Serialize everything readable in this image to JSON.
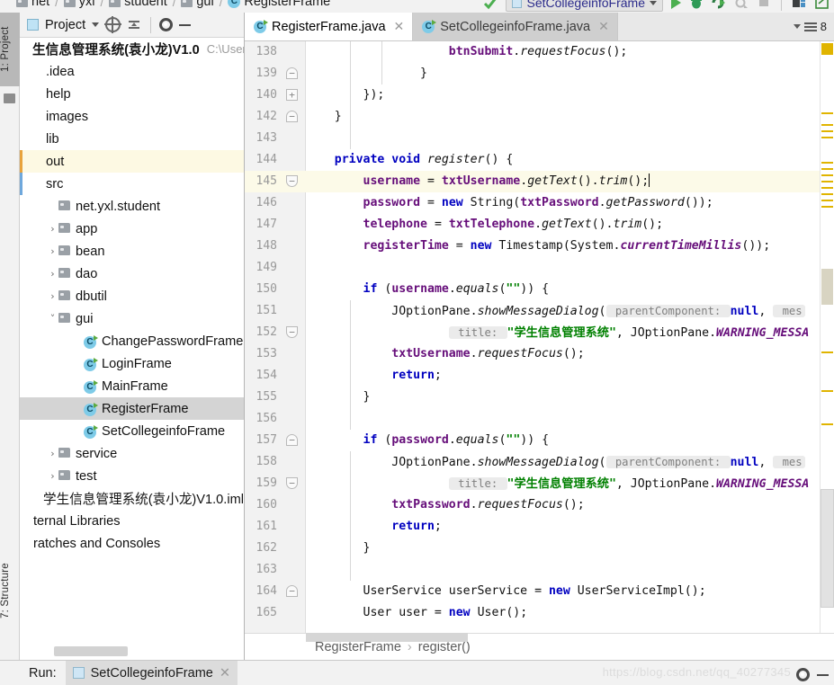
{
  "breadcrumb_top": {
    "items": [
      "net",
      "yxl",
      "student",
      "gui",
      "RegisterFrame"
    ]
  },
  "toolbar": {
    "run_config": "SetCollegeinfoFrame",
    "icons": [
      "run-icon",
      "debug-icon",
      "run-coverage-icon",
      "profile-icon",
      "stop-icon",
      "layout-icon",
      "open-window-icon"
    ]
  },
  "tool_tabs": {
    "left_top": "1: Project",
    "left_bottom": "7: Structure"
  },
  "project_panel": {
    "title": "Project",
    "root": {
      "name": "生信息管理系统(袁小龙)V1.0",
      "path": "C:\\User"
    },
    "items": [
      {
        "label": ".idea",
        "indent": 1,
        "icon": "folder-icon",
        "arrow": "",
        "state": "normal"
      },
      {
        "label": "help",
        "indent": 1,
        "icon": "folder-icon",
        "arrow": "",
        "state": "normal"
      },
      {
        "label": "images",
        "indent": 1,
        "icon": "folder-icon",
        "arrow": "",
        "state": "normal"
      },
      {
        "label": "lib",
        "indent": 1,
        "icon": "folder-icon",
        "arrow": "",
        "state": "normal"
      },
      {
        "label": "out",
        "indent": 1,
        "icon": "folder-icon",
        "arrow": "",
        "state": "excluded"
      },
      {
        "label": "src",
        "indent": 1,
        "icon": "source-folder-icon",
        "arrow": "",
        "state": "source"
      },
      {
        "label": "net.yxl.student",
        "indent": 2,
        "icon": "package-icon",
        "arrow": "",
        "state": "normal"
      },
      {
        "label": "app",
        "indent": 2,
        "icon": "package-icon",
        "arrow": "›",
        "state": "normal"
      },
      {
        "label": "bean",
        "indent": 2,
        "icon": "package-icon",
        "arrow": "›",
        "state": "normal"
      },
      {
        "label": "dao",
        "indent": 2,
        "icon": "package-icon",
        "arrow": "›",
        "state": "normal"
      },
      {
        "label": "dbutil",
        "indent": 2,
        "icon": "package-icon",
        "arrow": "›",
        "state": "normal"
      },
      {
        "label": "gui",
        "indent": 2,
        "icon": "package-icon",
        "arrow": "˅",
        "state": "normal"
      },
      {
        "label": "ChangePasswordFrame",
        "indent": 4,
        "icon": "java-class-icon",
        "arrow": "",
        "state": "normal"
      },
      {
        "label": "LoginFrame",
        "indent": 4,
        "icon": "java-runnable-class-icon",
        "arrow": "",
        "state": "normal"
      },
      {
        "label": "MainFrame",
        "indent": 4,
        "icon": "java-runnable-class-icon",
        "arrow": "",
        "state": "normal"
      },
      {
        "label": "RegisterFrame",
        "indent": 4,
        "icon": "java-runnable-class-icon",
        "arrow": "",
        "state": "selected"
      },
      {
        "label": "SetCollegeinfoFrame",
        "indent": 4,
        "icon": "java-runnable-class-icon",
        "arrow": "",
        "state": "normal"
      },
      {
        "label": "service",
        "indent": 2,
        "icon": "package-icon",
        "arrow": "›",
        "state": "normal"
      },
      {
        "label": "test",
        "indent": 2,
        "icon": "package-icon",
        "arrow": "›",
        "state": "normal"
      },
      {
        "label": "学生信息管理系统(袁小龙)V1.0.iml",
        "indent": 1,
        "icon": "iml-file-icon",
        "arrow": "",
        "state": "normal"
      },
      {
        "label": "ternal Libraries",
        "indent": 0,
        "icon": "library-icon",
        "arrow": "",
        "state": "normal"
      },
      {
        "label": "ratches and Consoles",
        "indent": 0,
        "icon": "scratches-icon",
        "arrow": "",
        "state": "normal"
      }
    ]
  },
  "editor": {
    "tabs": [
      {
        "label": "RegisterFrame.java",
        "active": true,
        "icon": "java-runnable-class-icon"
      },
      {
        "label": "SetCollegeinfoFrame.java",
        "active": false,
        "icon": "java-runnable-class-icon"
      }
    ],
    "tab_count": "8",
    "lines": [
      {
        "num": "138",
        "segs": [
          {
            "t": "                    ",
            "c": "plain"
          },
          {
            "t": "btnSubmit",
            "c": "fld"
          },
          {
            "t": ".",
            "c": "plain"
          },
          {
            "t": "requestFocus",
            "c": "mth"
          },
          {
            "t": "();",
            "c": "plain"
          }
        ]
      },
      {
        "num": "139",
        "segs": [
          {
            "t": "                }",
            "c": "plain"
          }
        ]
      },
      {
        "num": "140",
        "segs": [
          {
            "t": "        });",
            "c": "plain"
          }
        ]
      },
      {
        "num": "142",
        "segs": [
          {
            "t": "    }",
            "c": "plain"
          }
        ]
      },
      {
        "num": "143",
        "segs": [
          {
            "t": "",
            "c": "plain"
          }
        ]
      },
      {
        "num": "144",
        "segs": [
          {
            "t": "    ",
            "c": "plain"
          },
          {
            "t": "private void ",
            "c": "kw"
          },
          {
            "t": "register",
            "c": "mth"
          },
          {
            "t": "() {",
            "c": "plain"
          }
        ]
      },
      {
        "num": "145",
        "current": true,
        "segs": [
          {
            "t": "        ",
            "c": "plain"
          },
          {
            "t": "username",
            "c": "fld"
          },
          {
            "t": " = ",
            "c": "plain"
          },
          {
            "t": "txtUsername",
            "c": "fld"
          },
          {
            "t": ".",
            "c": "plain"
          },
          {
            "t": "getText",
            "c": "mth"
          },
          {
            "t": "().",
            "c": "plain"
          },
          {
            "t": "trim",
            "c": "mth"
          },
          {
            "t": "();",
            "c": "plain"
          }
        ],
        "caret": true
      },
      {
        "num": "146",
        "segs": [
          {
            "t": "        ",
            "c": "plain"
          },
          {
            "t": "password",
            "c": "fld"
          },
          {
            "t": " = ",
            "c": "plain"
          },
          {
            "t": "new ",
            "c": "kw"
          },
          {
            "t": "String(",
            "c": "plain"
          },
          {
            "t": "txtPassword",
            "c": "fld"
          },
          {
            "t": ".",
            "c": "plain"
          },
          {
            "t": "getPassword",
            "c": "mth"
          },
          {
            "t": "());",
            "c": "plain"
          }
        ]
      },
      {
        "num": "147",
        "segs": [
          {
            "t": "        ",
            "c": "plain"
          },
          {
            "t": "telephone",
            "c": "fld"
          },
          {
            "t": " = ",
            "c": "plain"
          },
          {
            "t": "txtTelephone",
            "c": "fld"
          },
          {
            "t": ".",
            "c": "plain"
          },
          {
            "t": "getText",
            "c": "mth"
          },
          {
            "t": "().",
            "c": "plain"
          },
          {
            "t": "trim",
            "c": "mth"
          },
          {
            "t": "();",
            "c": "plain"
          }
        ]
      },
      {
        "num": "148",
        "segs": [
          {
            "t": "        ",
            "c": "plain"
          },
          {
            "t": "registerTime",
            "c": "fld"
          },
          {
            "t": " = ",
            "c": "plain"
          },
          {
            "t": "new ",
            "c": "kw"
          },
          {
            "t": "Timestamp(System.",
            "c": "plain"
          },
          {
            "t": "currentTimeMillis",
            "c": "stat"
          },
          {
            "t": "());",
            "c": "plain"
          }
        ]
      },
      {
        "num": "149",
        "segs": [
          {
            "t": "",
            "c": "plain"
          }
        ]
      },
      {
        "num": "150",
        "segs": [
          {
            "t": "        ",
            "c": "plain"
          },
          {
            "t": "if ",
            "c": "kw"
          },
          {
            "t": "(",
            "c": "plain"
          },
          {
            "t": "username",
            "c": "fld"
          },
          {
            "t": ".",
            "c": "plain"
          },
          {
            "t": "equals",
            "c": "mth"
          },
          {
            "t": "(",
            "c": "plain"
          },
          {
            "t": "\"\"",
            "c": "str"
          },
          {
            "t": ")) {",
            "c": "plain"
          }
        ]
      },
      {
        "num": "151",
        "segs": [
          {
            "t": "            ",
            "c": "plain"
          },
          {
            "t": "JOptionPane.",
            "c": "plain"
          },
          {
            "t": "showMessageDialog",
            "c": "mth"
          },
          {
            "t": "(",
            "c": "plain"
          },
          {
            "t": " parentComponent: ",
            "c": "hint"
          },
          {
            "t": "null",
            "c": "kw"
          },
          {
            "t": ", ",
            "c": "plain"
          },
          {
            "t": " mes",
            "c": "hint"
          }
        ]
      },
      {
        "num": "152",
        "segs": [
          {
            "t": "                    ",
            "c": "plain"
          },
          {
            "t": " title: ",
            "c": "hint"
          },
          {
            "t": "\"学生信息管理系统\"",
            "c": "str"
          },
          {
            "t": ", JOptionPane.",
            "c": "plain"
          },
          {
            "t": "WARNING_MESSA",
            "c": "stat"
          }
        ]
      },
      {
        "num": "153",
        "segs": [
          {
            "t": "            ",
            "c": "plain"
          },
          {
            "t": "txtUsername",
            "c": "fld"
          },
          {
            "t": ".",
            "c": "plain"
          },
          {
            "t": "requestFocus",
            "c": "mth"
          },
          {
            "t": "();",
            "c": "plain"
          }
        ]
      },
      {
        "num": "154",
        "segs": [
          {
            "t": "            ",
            "c": "plain"
          },
          {
            "t": "return",
            "c": "kw"
          },
          {
            "t": ";",
            "c": "plain"
          }
        ]
      },
      {
        "num": "155",
        "segs": [
          {
            "t": "        }",
            "c": "plain"
          }
        ]
      },
      {
        "num": "156",
        "segs": [
          {
            "t": "",
            "c": "plain"
          }
        ]
      },
      {
        "num": "157",
        "segs": [
          {
            "t": "        ",
            "c": "plain"
          },
          {
            "t": "if ",
            "c": "kw"
          },
          {
            "t": "(",
            "c": "plain"
          },
          {
            "t": "password",
            "c": "fld"
          },
          {
            "t": ".",
            "c": "plain"
          },
          {
            "t": "equals",
            "c": "mth"
          },
          {
            "t": "(",
            "c": "plain"
          },
          {
            "t": "\"\"",
            "c": "str"
          },
          {
            "t": ")) {",
            "c": "plain"
          }
        ]
      },
      {
        "num": "158",
        "segs": [
          {
            "t": "            ",
            "c": "plain"
          },
          {
            "t": "JOptionPane.",
            "c": "plain"
          },
          {
            "t": "showMessageDialog",
            "c": "mth"
          },
          {
            "t": "(",
            "c": "plain"
          },
          {
            "t": " parentComponent: ",
            "c": "hint"
          },
          {
            "t": "null",
            "c": "kw"
          },
          {
            "t": ", ",
            "c": "plain"
          },
          {
            "t": " mes",
            "c": "hint"
          }
        ]
      },
      {
        "num": "159",
        "segs": [
          {
            "t": "                    ",
            "c": "plain"
          },
          {
            "t": " title: ",
            "c": "hint"
          },
          {
            "t": "\"学生信息管理系统\"",
            "c": "str"
          },
          {
            "t": ", JOptionPane.",
            "c": "plain"
          },
          {
            "t": "WARNING_MESSA",
            "c": "stat"
          }
        ]
      },
      {
        "num": "160",
        "segs": [
          {
            "t": "            ",
            "c": "plain"
          },
          {
            "t": "txtPassword",
            "c": "fld"
          },
          {
            "t": ".",
            "c": "plain"
          },
          {
            "t": "requestFocus",
            "c": "mth"
          },
          {
            "t": "();",
            "c": "plain"
          }
        ]
      },
      {
        "num": "161",
        "segs": [
          {
            "t": "            ",
            "c": "plain"
          },
          {
            "t": "return",
            "c": "kw"
          },
          {
            "t": ";",
            "c": "plain"
          }
        ]
      },
      {
        "num": "162",
        "segs": [
          {
            "t": "        }",
            "c": "plain"
          }
        ]
      },
      {
        "num": "163",
        "segs": [
          {
            "t": "",
            "c": "plain"
          }
        ]
      },
      {
        "num": "164",
        "segs": [
          {
            "t": "        UserService userService = ",
            "c": "plain"
          },
          {
            "t": "new ",
            "c": "kw"
          },
          {
            "t": "UserServiceImpl();",
            "c": "plain"
          }
        ]
      },
      {
        "num": "165",
        "segs": [
          {
            "t": "        User user = ",
            "c": "plain"
          },
          {
            "t": "new ",
            "c": "kw"
          },
          {
            "t": "User();",
            "c": "plain"
          }
        ]
      }
    ],
    "breadcrumb": {
      "class": "RegisterFrame",
      "method": "register()",
      "separator": "›"
    }
  },
  "run_panel": {
    "label": "Run:",
    "tab": "SetCollegeinfoFrame"
  },
  "watermark": "https://blog.csdn.net/qq_40277345",
  "colors": {
    "keyword": "#0000c0",
    "field": "#660e7a",
    "string": "#008000",
    "hint": "#808080",
    "selection": "#d4d4d4",
    "current_line": "#fcfae8",
    "warning_stripe": "#e0b400"
  }
}
